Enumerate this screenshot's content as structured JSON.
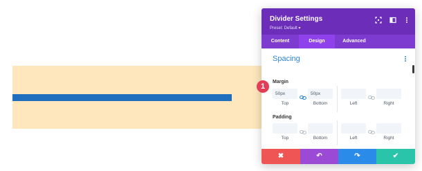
{
  "panel": {
    "title": "Divider Settings",
    "preset": "Preset: Default ▾",
    "tabs": [
      {
        "label": "Content"
      },
      {
        "label": "Design"
      },
      {
        "label": "Advanced"
      }
    ],
    "active_tab": "Design",
    "section_title": "Spacing",
    "margin": {
      "label": "Margin",
      "fields": [
        {
          "sub": "Top",
          "value": "50px",
          "placeholder": ""
        },
        {
          "sub": "Bottom",
          "value": "50px",
          "placeholder": ""
        },
        {
          "sub": "Left",
          "value": "",
          "placeholder": ""
        },
        {
          "sub": "Right",
          "value": "",
          "placeholder": ""
        }
      ]
    },
    "padding": {
      "label": "Padding",
      "fields": [
        {
          "sub": "Top",
          "value": "",
          "placeholder": ""
        },
        {
          "sub": "Bottom",
          "value": "",
          "placeholder": ""
        },
        {
          "sub": "Left",
          "value": "",
          "placeholder": ""
        },
        {
          "sub": "Right",
          "value": "",
          "placeholder": ""
        }
      ]
    },
    "footer": [
      {
        "name": "cancel",
        "glyph": "✖",
        "color": "#ef5555"
      },
      {
        "name": "undo",
        "glyph": "↶",
        "color": "#9b4ad6"
      },
      {
        "name": "redo",
        "glyph": "↷",
        "color": "#2b8be8"
      },
      {
        "name": "save",
        "glyph": "✔",
        "color": "#29c4a9"
      }
    ]
  },
  "step_badge": "1",
  "colors": {
    "header": "#6c2eb9",
    "tabs": "#7e3bd0",
    "section_bg": "#fee7bd",
    "divider": "#1f6fbe",
    "accent": "#2b87da"
  },
  "icons": [
    "expand-icon",
    "sidebar-icon",
    "more-icon",
    "link-icon",
    "kebab-icon"
  ]
}
